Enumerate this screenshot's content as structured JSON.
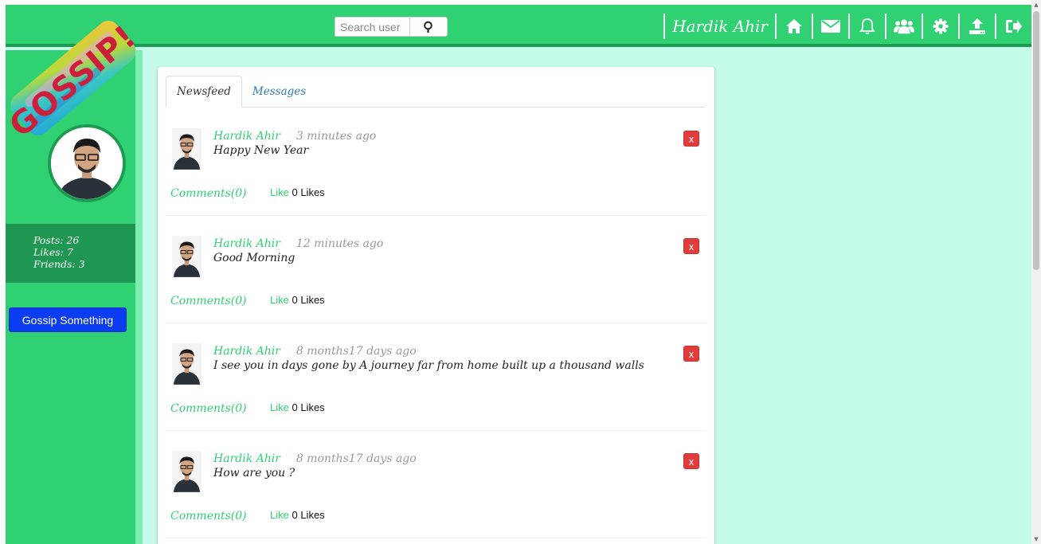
{
  "app": {
    "logo_text": "GOSSIP!",
    "accent_color": "#2fd173",
    "dark_accent_color": "#1c9c52",
    "background_color": "#c5fbea"
  },
  "header": {
    "search": {
      "placeholder": "Search user",
      "value": ""
    },
    "user_name": "Hardik Ahir",
    "icons": [
      "home-icon",
      "envelope-icon",
      "bell-icon",
      "users-icon",
      "gear-icon",
      "upload-icon",
      "sign-out-icon"
    ]
  },
  "sidebar": {
    "stats": {
      "posts": "Posts: 26",
      "likes": "Likes: 7",
      "friends": "Friends: 3"
    },
    "gossip_button": "Gossip Something"
  },
  "tabs": [
    {
      "label": "Newsfeed",
      "active": true
    },
    {
      "label": "Messages",
      "active": false
    }
  ],
  "posts": [
    {
      "author": "Hardik Ahir",
      "time": "3 minutes ago",
      "content": "Happy New Year",
      "delete_label": "x",
      "comments": "Comments(0)",
      "like_label": "Like",
      "likes": "0 Likes"
    },
    {
      "author": "Hardik Ahir",
      "time": "12 minutes ago",
      "content": "Good Morning",
      "delete_label": "x",
      "comments": "Comments(0)",
      "like_label": "Like",
      "likes": "0 Likes"
    },
    {
      "author": "Hardik Ahir",
      "time": "8 months17 days ago",
      "content": "I see you in days gone by A journey far from home built up a thousand walls",
      "delete_label": "x",
      "comments": "Comments(0)",
      "like_label": "Like",
      "likes": "0 Likes"
    },
    {
      "author": "Hardik Ahir",
      "time": "8 months17 days ago",
      "content": "How are you ?",
      "delete_label": "x",
      "comments": "Comments(0)",
      "like_label": "Like",
      "likes": "0 Likes"
    }
  ]
}
